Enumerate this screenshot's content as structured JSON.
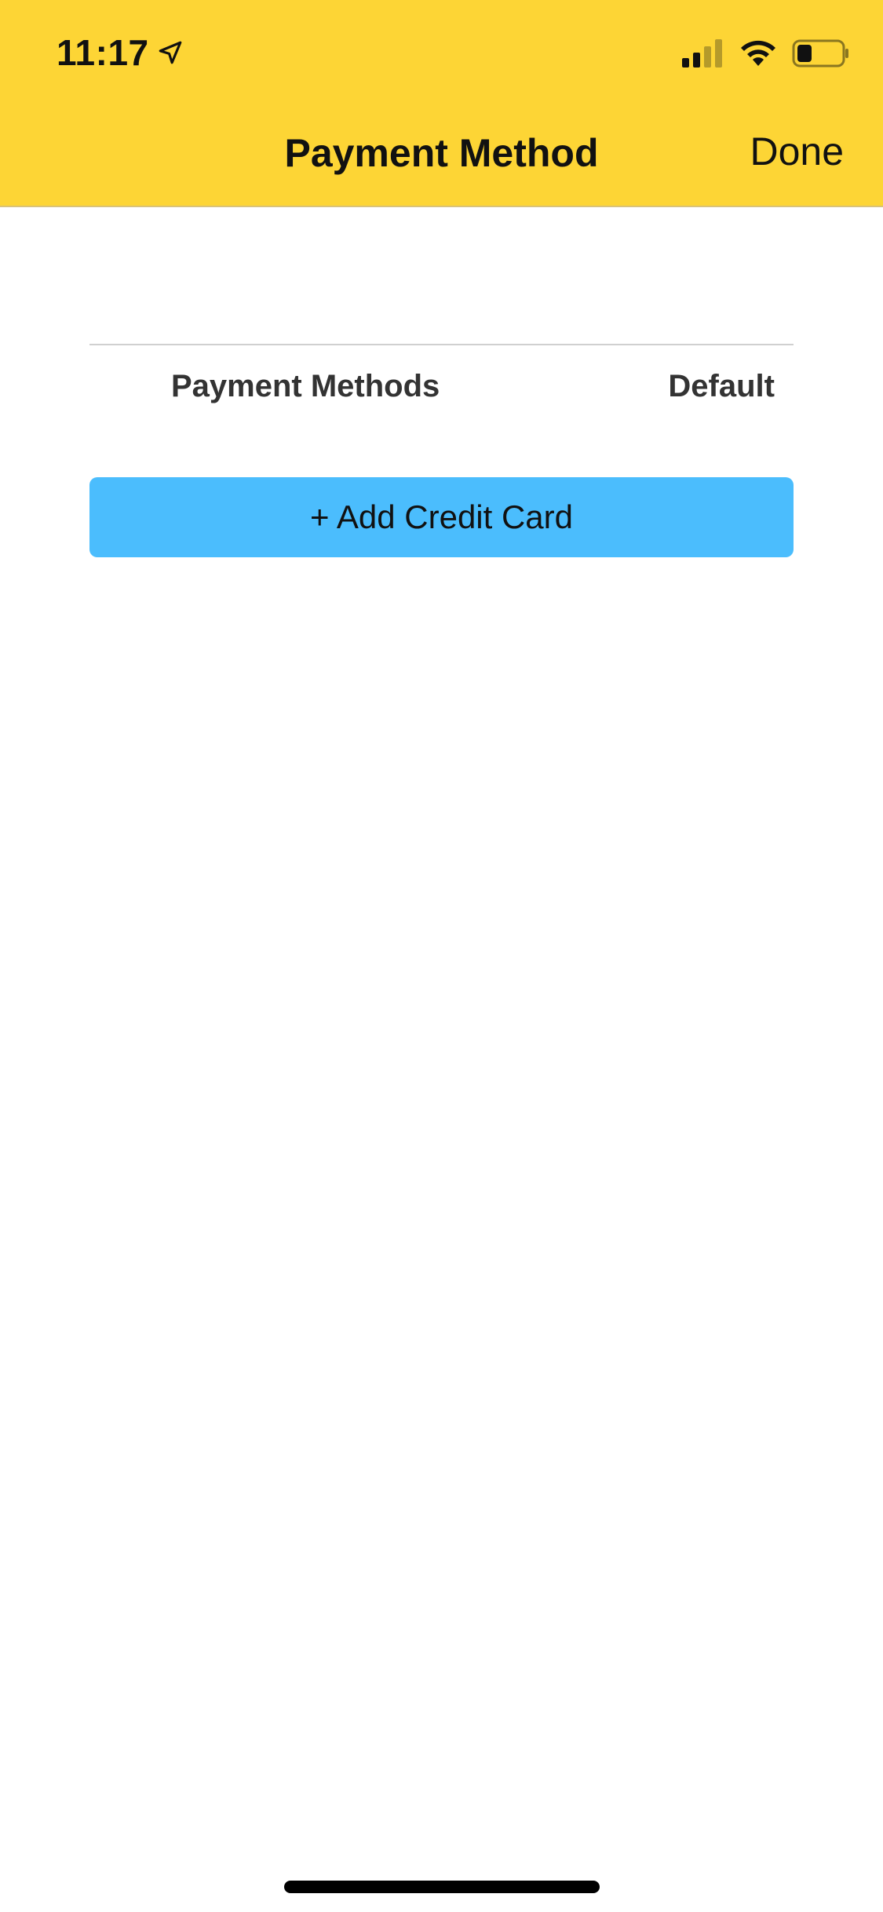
{
  "status_bar": {
    "time": "11:17",
    "location_icon": "location-arrow-icon",
    "signal_icon": "cellular-signal-icon",
    "wifi_icon": "wifi-icon",
    "battery_icon": "battery-icon"
  },
  "nav": {
    "title": "Payment Method",
    "done_label": "Done"
  },
  "table": {
    "columns": [
      "Payment Methods",
      "Default"
    ]
  },
  "actions": {
    "add_card_label": "+ Add Credit Card"
  },
  "colors": {
    "header_bg": "#FDD535",
    "button_bg": "#4BBDFD"
  }
}
